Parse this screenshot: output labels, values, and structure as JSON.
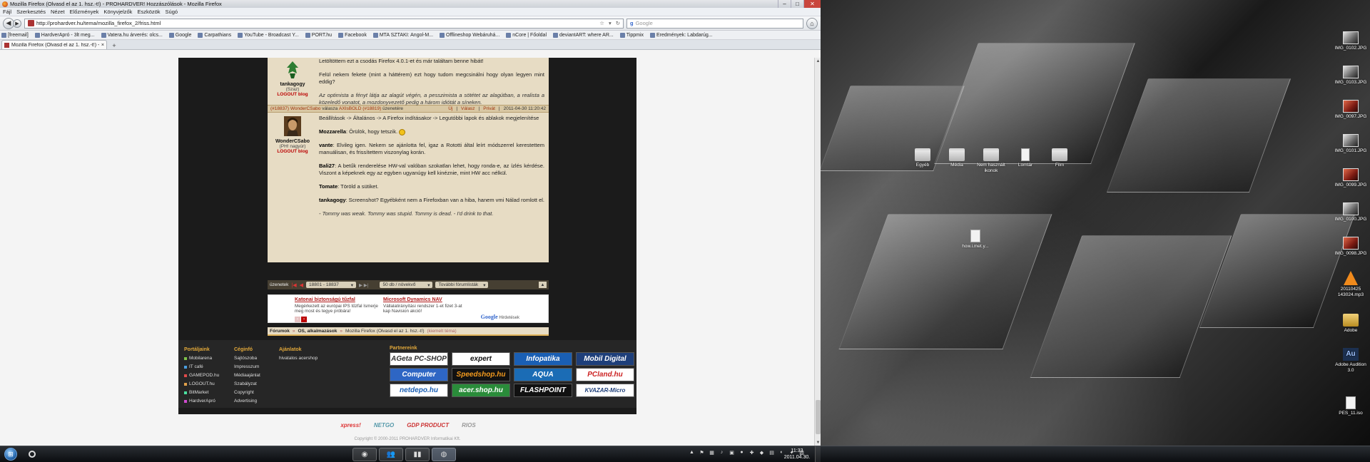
{
  "window": {
    "title": "Mozilla Firefox (Olvasd el az 1. hsz.-t!) - PROHARDVER! Hozzászólások - Mozilla Firefox",
    "menu": [
      "Fájl",
      "Szerkesztés",
      "Nézet",
      "Előzmények",
      "Könyvjelzők",
      "Eszközök",
      "Súgó"
    ],
    "url": "http://prohardver.hu/tema/mozilla_firefox_2/friss.html",
    "search_placeholder": "Google",
    "bookmarks": [
      "[freemail]",
      "HardverApró - 3lt meg...",
      "Vatera.hu árverés: olcs...",
      "Google",
      "Carpathians",
      "YouTube - Broadcast Y...",
      "PORT.hu",
      "Facebook",
      "MTA SZTAKI: Angol-M...",
      "Offlineshop Webáruhá...",
      "nCore | Főoldal",
      "deviantART: where AR...",
      "Tippmix",
      "Eredmények: Labdarúg..."
    ],
    "tab_title": "Mozilla Firefox (Olvasd el az 1. hsz.-t!) - ...",
    "new_tab": "+"
  },
  "post1": {
    "author": "tankagogy",
    "rank": "(Szaz)",
    "blog": "LOGOUT blog",
    "paragraphs": [
      "Letöltöttem ezt a csodás Firefox 4.0.1-et és már találtam benne hibát!",
      "Felül nekem fekete (mint a háttérem) ezt hogy tudom megcsinálni hogy olyan legyen mint eddig?"
    ],
    "quote": "Az optimista a fényt látja az alagút végén, a pesszimista a sötétet az alagútban, a realista a közeledő vonatot, a mozdonyvezető pedig a három idiótát a síneken."
  },
  "post2_header": {
    "ref_left": "(#18837)",
    "author_link": "WonderCSabo",
    "reply_to": "válasza",
    "target_link": "AXIsBOLD",
    "ref_right": "(#18819)",
    "suffix": "üzenetére",
    "actions": [
      "Új",
      "Válasz",
      "Privát"
    ],
    "timestamp": "2011-04-30 11:20:42"
  },
  "post2": {
    "author": "WonderCSabo",
    "rank": "(PH! nagyúr)",
    "blog": "LOGOUT blog",
    "p1": "Beállítások -> Általános -> A Firefox indításakor -> Legutóbbi lapok és ablakok megjelenítése",
    "p2_name": "Mozzarella",
    "p2_text": ": Örülök, hogy tetszik.",
    "p3_name": "vante",
    "p3_text": ": Elvileg igen. Nekem se ajánlotta fel, igaz a Rototti által leírt módszerrel kerestettem manuálisan, és frissítettem viszonylag korán.",
    "p4_name": "Bali27",
    "p4_text": ": A betűk renderelése HW-val valóban szokatlan lehet, hogy ronda-e, az ízlés kérdése. Viszont a képeknek egy az egyben ugyanúgy kell kinéznie, mint HW acc nélkül.",
    "p5_name": "Tomate",
    "p5_text": ": Töröld a sütiket.",
    "p6_name": "tankagogy",
    "p6_text": ": Screenshot? Egyébként nem a Firefoxban van a hiba, hanem vmi Nálad romlott el.",
    "quote": "- Tommy was weak. Tommy was stupid. Tommy is dead. - I'd drink to that."
  },
  "pager": {
    "label": "üzenetek",
    "range": "18801 - 18837",
    "per_page": "50 db / növekvő",
    "forums": "További fórumlisták"
  },
  "ads": {
    "ad1_title": "Katonai biztonságú tűzfal",
    "ad1_text": "Megérkezett az európai IPS tűzfal Ismerje meg most és tegye próbára!",
    "ad2_title": "Microsoft Dynamics NAV",
    "ad2_text": "Vállalatirányítási rendszer 1-et fizet 3-at kap Navision akció!",
    "google_logo": "Google",
    "google_text": "Hirdetések"
  },
  "breadcrumb": {
    "items": [
      "Fórumok",
      "OS, alkalmazások",
      "Mozilla Firefox (Olvasd el az 1. hsz.-t!)"
    ],
    "sep": "»",
    "suffix": "(kiemelt téma)"
  },
  "footer": {
    "col1_title": "Portáljaink",
    "col1": [
      "Mobilarena",
      "IT café",
      "GAMEPOD.hu",
      "LOGOUT.hu",
      "BitMarket",
      "HardverApró"
    ],
    "col1_colors": [
      "#7fc24a",
      "#4a9ee0",
      "#e04a4a",
      "#e0a04a",
      "#4ae0a0",
      "#d04ad0"
    ],
    "col2_title": "Céginfó",
    "col2": [
      "Sajtószoba",
      "Impresszum",
      "Médiaajánlat",
      "Szabályzat",
      "Copyright",
      "Advertising"
    ],
    "col3_title": "Ajánlatok",
    "col3": [
      "hivatalos acershop"
    ],
    "partners_title": "Partnereink",
    "partners": [
      "AGeta PC-SHOP",
      "expert",
      "Infopatika",
      "Mobil Digital",
      "Computer",
      "Speedshop.hu",
      "AQUA",
      "PCland.hu",
      "netdepo.hu",
      "acer.shop.hu",
      "FLASHPOINT",
      "KVAZAR-Micro"
    ]
  },
  "brands": [
    "xpress!",
    "NETGO",
    "GDP PRODUCT",
    "RIOS"
  ],
  "copyright": "Copyright © 2000-2011 PROHARDVER Informatikai Kft.",
  "desktop": {
    "icons": [
      "IMG_0102.JPG",
      "IMG_0103.JPG",
      "IMG_0097.JPG",
      "IMG_0101.JPG",
      "IMG_0099.JPG",
      "IMG_0100.JPG",
      "IMG_0098.JPG",
      "20110425 143024.mp3",
      "Adobe",
      "Adobe Audition 3.0",
      "PES_11.iso"
    ],
    "folders": [
      "Egyéb",
      "Média",
      "Nem használt ikonok",
      "Lomtár",
      "Film"
    ],
    "file": "how.i.met.y..."
  },
  "taskbar": {
    "time": "11:33",
    "date": "2011.04.30."
  }
}
